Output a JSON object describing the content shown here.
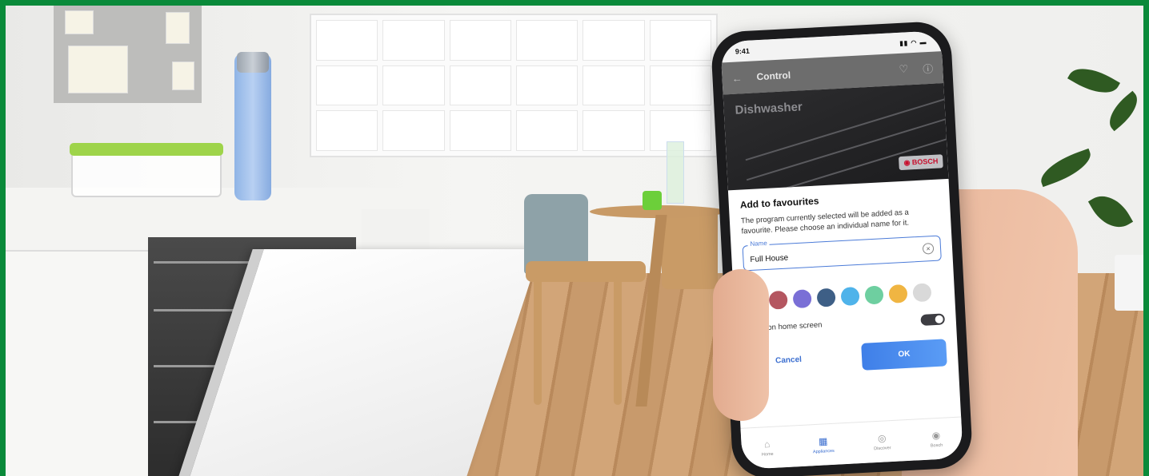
{
  "phone": {
    "status_time": "9:41",
    "status_icons": "▮▮ ◠ ▬",
    "appbar": {
      "title": "Control",
      "back_icon": "arrow-left-icon",
      "favourite_icon": "heart-icon",
      "info_icon": "info-icon"
    },
    "hero": {
      "appliance_name": "Dishwasher",
      "brand": "◉ BOSCH"
    },
    "dialog": {
      "title": "Add to favourites",
      "description": "The program currently selected will be added as a favourite. Please choose an individual name for it.",
      "name_label": "Name",
      "name_value": "Full House",
      "clear_icon": "clear-icon",
      "color_label": "Color",
      "colors": [
        "#e8876e",
        "#b45660",
        "#7a6fd6",
        "#3e5f86",
        "#4fb3ea",
        "#6ecfa0",
        "#f0b542",
        "#d9d9d9"
      ],
      "selected_color_mark": "✓",
      "show_on_home_label": "Show on home screen",
      "show_on_home": true,
      "cancel_label": "Cancel",
      "ok_label": "OK"
    },
    "tabs": [
      {
        "label": "Home",
        "icon": "⌂"
      },
      {
        "label": "Appliances",
        "icon": "▦"
      },
      {
        "label": "Discover",
        "icon": "◎"
      },
      {
        "label": "Bosch",
        "icon": "◉"
      }
    ]
  }
}
